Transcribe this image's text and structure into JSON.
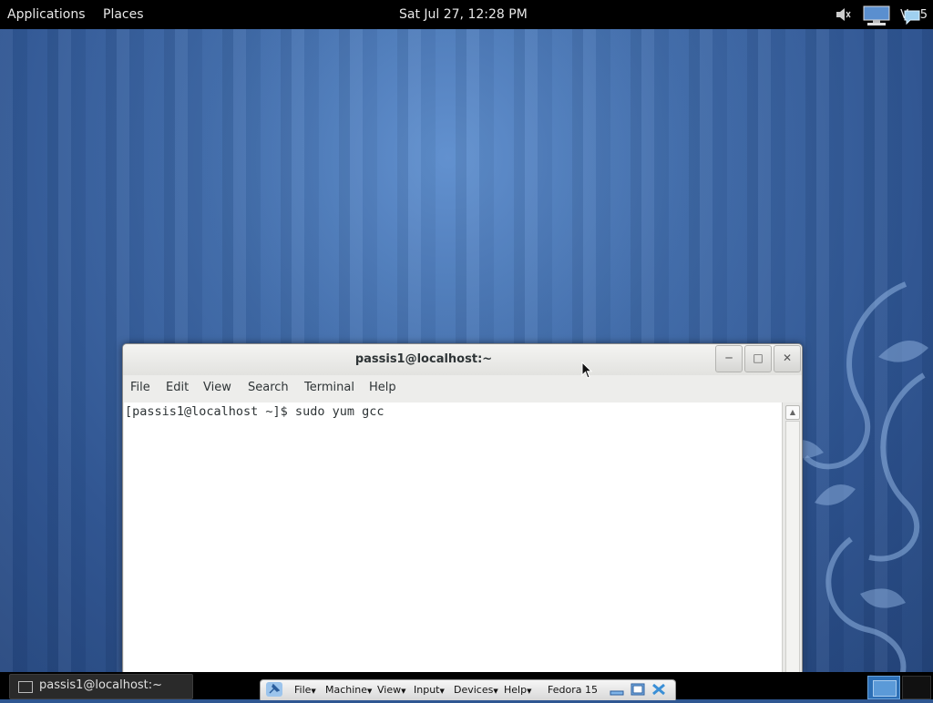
{
  "top_panel": {
    "applications": "Applications",
    "places": "Places",
    "clock": "Sat Jul 27, 12:28 PM",
    "user": "Vm5",
    "icons": [
      "volume-muted-icon",
      "network-icon",
      "chat-icon"
    ]
  },
  "terminal": {
    "title": "passis1@localhost:~",
    "menu": [
      "File",
      "Edit",
      "View",
      "Search",
      "Terminal",
      "Help"
    ],
    "line": "[passis1@localhost ~]$ sudo yum gcc",
    "buttons": [
      "minimize",
      "maximize",
      "close"
    ]
  },
  "taskbar": {
    "task_label": "passis1@localhost:~"
  },
  "virtualbox": {
    "menu": [
      "File",
      "Machine",
      "View",
      "Input",
      "Devices",
      "Help"
    ],
    "vm_name": "Fedora 15"
  },
  "colors": {
    "panel": "#000000",
    "desktop_blue": "#3f6aa8",
    "workspace_active": "#2c6fb6"
  }
}
